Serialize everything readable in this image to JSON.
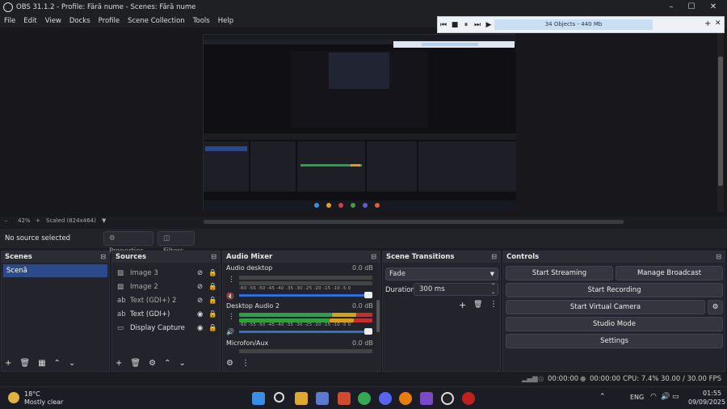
{
  "window": {
    "title": "OBS 31.1.2 - Profile: Fără nume - Scenes: Fără nume",
    "minimize": "–",
    "maximize": "☐",
    "close": "✕"
  },
  "menu": [
    "File",
    "Edit",
    "View",
    "Docks",
    "Profile",
    "Scene Collection",
    "Tools",
    "Help"
  ],
  "playbar": {
    "status": "34 Objects - 440 Mb",
    "add": "+",
    "close": "✕"
  },
  "zoom": {
    "minus": "–",
    "value": "42%",
    "plus": "+",
    "scale": "Scaled (824x464)"
  },
  "props": {
    "no_source": "No source selected",
    "properties": "Properties",
    "filters": "Filters"
  },
  "scenes": {
    "title": "Scenes",
    "items": [
      "Scenă"
    ]
  },
  "sources": {
    "title": "Sources",
    "items": [
      {
        "name": "Image 3",
        "icon": "image-icon",
        "visible": false
      },
      {
        "name": "Image 2",
        "icon": "image-icon",
        "visible": false
      },
      {
        "name": "Text (GDI+) 2",
        "icon": "text-icon",
        "visible": false
      },
      {
        "name": "Text (GDI+)",
        "icon": "text-icon",
        "visible": true
      },
      {
        "name": "Display Capture",
        "icon": "monitor-icon",
        "visible": true
      }
    ]
  },
  "mixer": {
    "title": "Audio Mixer",
    "channels": [
      {
        "name": "Audio desktop",
        "db": "0.0 dB",
        "level": 0.0
      },
      {
        "name": "Desktop Audio 2",
        "db": "0.0 dB",
        "level": 0.92
      },
      {
        "name": "Microfon/Aux",
        "db": "0.0 dB",
        "level": 0.0
      }
    ],
    "scale": [
      "-60",
      "-55",
      "-50",
      "-45",
      "-40",
      "-35",
      "-30",
      "-25",
      "-20",
      "-15",
      "-10",
      "-5",
      "0"
    ]
  },
  "transitions": {
    "title": "Scene Transitions",
    "selected": "Fade",
    "duration_label": "Duration",
    "duration_value": "300 ms"
  },
  "controls": {
    "title": "Controls",
    "start_streaming": "Start Streaming",
    "manage_broadcast": "Manage Broadcast",
    "start_recording": "Start Recording",
    "start_virtual_camera": "Start Virtual Camera",
    "studio_mode": "Studio Mode",
    "settings": "Settings"
  },
  "status": {
    "stream_time": "00:00:00",
    "rec_time": "00:00:00",
    "cpu": "CPU: 7.4%",
    "fps": "30.00 / 30.00 FPS"
  },
  "taskbar": {
    "temp": "18°C",
    "weather": "Mostly clear",
    "lang": "ENG",
    "time": "01:55",
    "date": "09/09/2025"
  }
}
